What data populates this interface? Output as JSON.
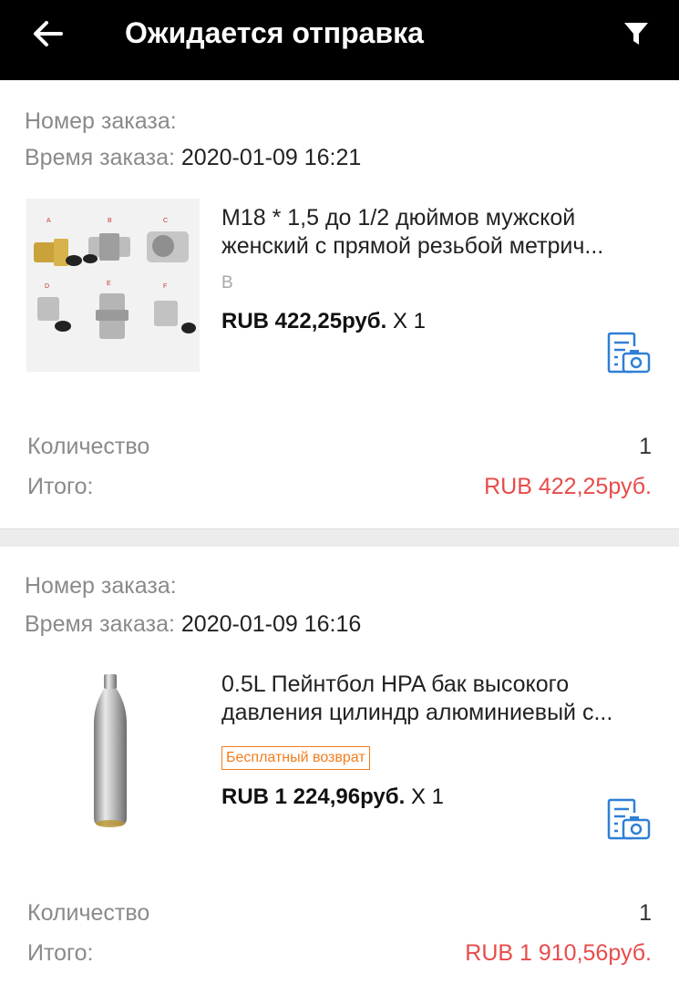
{
  "header": {
    "title": "Ожидается отправка",
    "back_icon": "arrow-left-icon",
    "filter_icon": "filter-icon"
  },
  "orders": [
    {
      "order_number_label": "Номер заказа:",
      "order_number": "",
      "order_time_label": "Время заказа:",
      "order_time": "2020-01-09 16:21",
      "product_title_line1": "M18 * 1,5 до 1/2 дюймов мужской",
      "product_title_line2": "женский с прямой резьбой метрич...",
      "variant": "B",
      "price": "RUB 422,25руб.",
      "qty_suffix": "X 1",
      "quantity_label": "Количество",
      "quantity": "1",
      "total_label": "Итого:",
      "total": "RUB 422,25руб.",
      "image_letters": [
        "A",
        "B",
        "C",
        "D",
        "E",
        "F"
      ],
      "review_icon": "photo-review-icon"
    },
    {
      "order_number_label": "Номер заказа:",
      "order_number": "",
      "order_time_label": "Время заказа:",
      "order_time": "2020-01-09 16:16",
      "product_title_line1": "0.5L Пейнтбол HPA бак высокого",
      "product_title_line2": "давления цилиндр алюминиевый с...",
      "badge": "Бесплатный возврат",
      "price": "RUB 1 224,96руб.",
      "qty_suffix": "X 1",
      "quantity_label": "Количество",
      "quantity": "1",
      "total_label": "Итого:",
      "total": "RUB 1 910,56руб.",
      "review_icon": "photo-review-icon"
    }
  ],
  "colors": {
    "header_bg": "#000000",
    "price_red": "#e84b4b",
    "badge_orange": "#f47c1c",
    "icon_blue": "#2f7fd6"
  }
}
